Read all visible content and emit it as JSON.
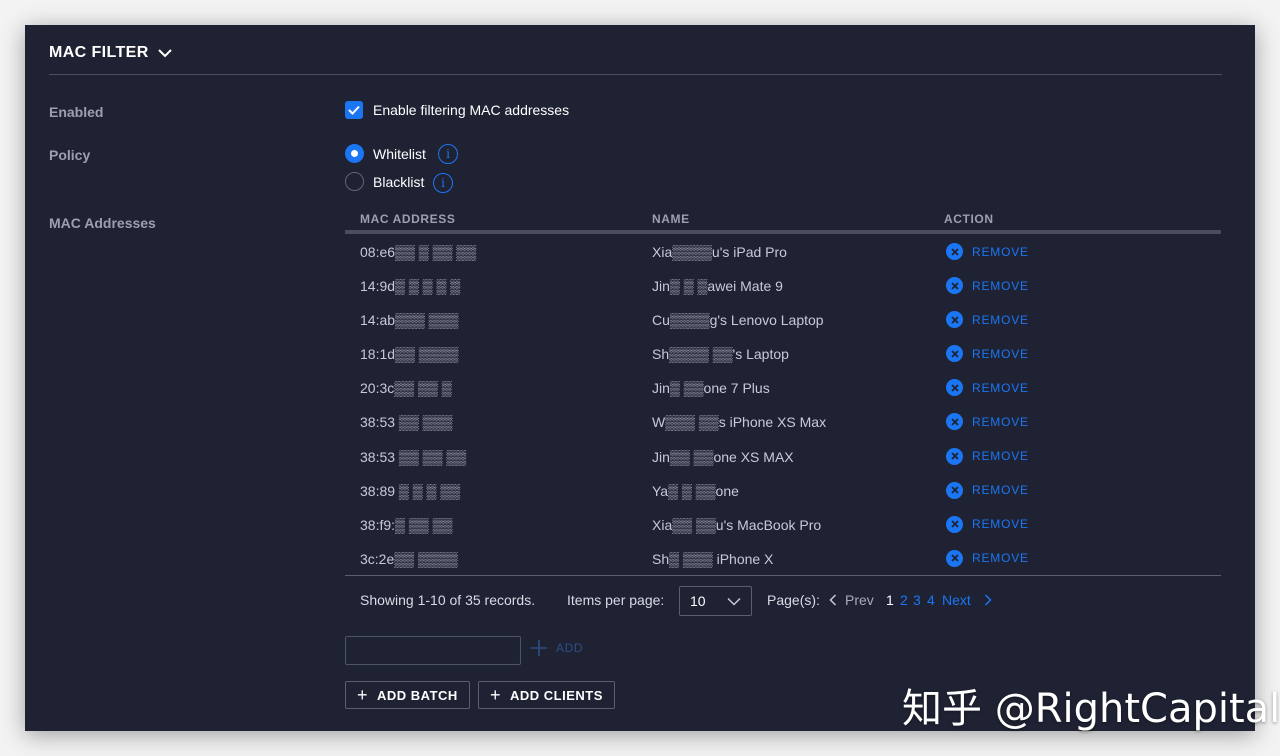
{
  "section": {
    "title": "MAC FILTER"
  },
  "labels": {
    "enabled": "Enabled",
    "policy": "Policy",
    "mac_addresses": "MAC Addresses"
  },
  "enable_filter": {
    "label": "Enable filtering MAC addresses",
    "checked": true
  },
  "policy": {
    "options": [
      {
        "label": "Whitelist",
        "selected": true
      },
      {
        "label": "Blacklist",
        "selected": false
      }
    ]
  },
  "table": {
    "columns": [
      "MAC ADDRESS",
      "NAME",
      "ACTION"
    ],
    "rows": [
      {
        "mac": "08:e6▒▒ ▒ ▒▒ ▒▒",
        "name": "Xia▒▒▒▒u's iPad Pro",
        "action": "REMOVE"
      },
      {
        "mac": "14:9d▒ ▒ ▒ ▒ ▒",
        "name": "Jin▒ ▒ ▒awei Mate 9",
        "action": "REMOVE"
      },
      {
        "mac": "14:ab▒▒▒ ▒▒▒",
        "name": "Cu▒▒▒▒g's Lenovo Laptop",
        "action": "REMOVE"
      },
      {
        "mac": "18:1d▒▒ ▒▒▒▒",
        "name": "Sh▒▒▒▒ ▒▒'s Laptop",
        "action": "REMOVE"
      },
      {
        "mac": "20:3c▒▒ ▒▒ ▒",
        "name": "Jin▒ ▒▒one 7 Plus",
        "action": "REMOVE"
      },
      {
        "mac": "38:53 ▒▒ ▒▒▒",
        "name": "W▒▒▒ ▒▒s iPhone XS Max",
        "action": "REMOVE"
      },
      {
        "mac": "38:53 ▒▒ ▒▒ ▒▒",
        "name": "Jin▒▒ ▒▒one XS MAX",
        "action": "REMOVE"
      },
      {
        "mac": "38:89 ▒ ▒ ▒ ▒▒",
        "name": "Ya▒ ▒ ▒▒one",
        "action": "REMOVE"
      },
      {
        "mac": "38:f9:▒ ▒▒ ▒▒",
        "name": "Xia▒▒ ▒▒u's MacBook Pro",
        "action": "REMOVE"
      },
      {
        "mac": "3c:2e▒▒ ▒▒▒▒",
        "name": "Sh▒ ▒▒▒ iPhone X",
        "action": "REMOVE"
      }
    ]
  },
  "pagination": {
    "showing_text": "Showing 1-10 of 35 records.",
    "items_per_page_label": "Items per page:",
    "items_per_page_value": "10",
    "pages_label": "Page(s):",
    "prev_label": "Prev",
    "pages": [
      "1",
      "2",
      "3",
      "4"
    ],
    "current_page": "1",
    "next_label": "Next"
  },
  "add": {
    "input_value": "",
    "add_label": "ADD"
  },
  "buttons": {
    "add_batch": "ADD BATCH",
    "add_clients": "ADD CLIENTS"
  },
  "watermark": "知乎 @RightCapital",
  "colors": {
    "accent": "#1b76f3",
    "panel_bg": "#1f2233",
    "page_bg": "#f3f3f3"
  }
}
